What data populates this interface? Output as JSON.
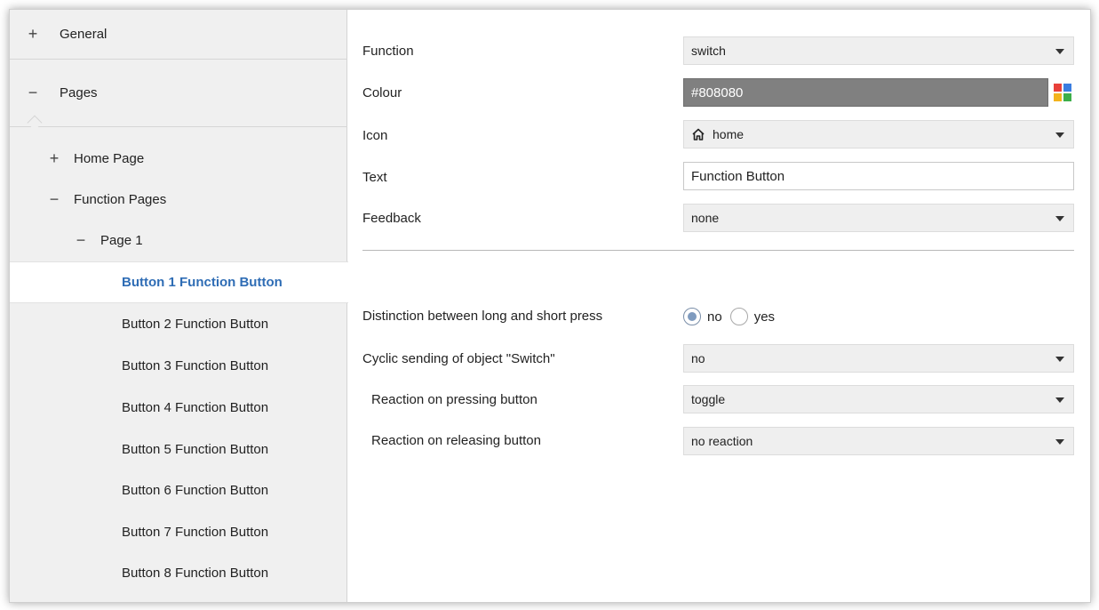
{
  "sidebar": {
    "general": {
      "symbol": "+",
      "label": "General"
    },
    "pages": {
      "symbol": "−",
      "label": "Pages"
    },
    "home_page": {
      "symbol": "+",
      "label": "Home Page"
    },
    "function_pages": {
      "symbol": "−",
      "label": "Function Pages"
    },
    "page1": {
      "symbol": "−",
      "label": "Page 1"
    },
    "buttons": [
      "Button 1 Function Button",
      "Button 2 Function Button",
      "Button 3 Function Button",
      "Button 4 Function Button",
      "Button 5 Function Button",
      "Button 6 Function Button",
      "Button 7 Function Button",
      "Button 8 Function Button"
    ],
    "selected_index": 0
  },
  "form": {
    "function": {
      "label": "Function",
      "value": "switch"
    },
    "colour": {
      "label": "Colour",
      "value": "#808080",
      "swatch_color": "#808080"
    },
    "icon": {
      "label": "Icon",
      "value": "home",
      "icon_name": "home-icon"
    },
    "text": {
      "label": "Text",
      "value": "Function Button"
    },
    "feedback": {
      "label": "Feedback",
      "value": "none"
    },
    "distinction": {
      "label": "Distinction between long and short press",
      "options": [
        "no",
        "yes"
      ],
      "selected": "no"
    },
    "cyclic": {
      "label": "Cyclic sending of object \"Switch\"",
      "value": "no"
    },
    "reaction_press": {
      "label": "Reaction on pressing button",
      "value": "toggle"
    },
    "reaction_release": {
      "label": "Reaction on releasing button",
      "value": "no reaction"
    }
  },
  "palette_colors": [
    "#e8403a",
    "#3a7de0",
    "#f3b31d",
    "#3cae4a"
  ],
  "accent_color": "#2f6db5"
}
